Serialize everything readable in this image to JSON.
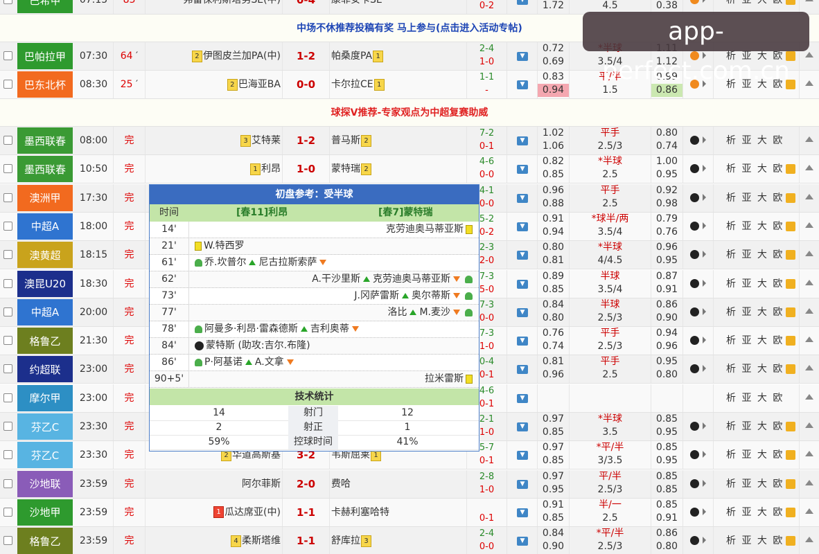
{
  "watermark": "app-perfect.com.cn",
  "banners": [
    "中场不休推荐投稿有奖 马上参与(点击进入活动专帖)",
    "球探V推荐-专家观点为中超复赛助威"
  ],
  "top_partial": {
    "league": "巴希甲",
    "time": "07:15",
    "status": "83",
    "home": "弗雷保利斯塔努SE(中)",
    "score": "0-4",
    "away": "康菲安卡SE",
    "half": "0-2",
    "o1": "1.72",
    "hc": "4.5",
    "o2": "0.38",
    "links": "析 亚 大 欧"
  },
  "matches": [
    {
      "league": "巴帕拉甲",
      "lcolor": "#2e9a2e",
      "time": "07:30",
      "status": "64",
      "live": true,
      "home": "伊图皮兰加PA(中)",
      "hrank": "2",
      "score": "1-2",
      "away": "帕桑度PA",
      "arank": "1",
      "half_top": "2-4",
      "half_bot": "1-0",
      "o1a": "0.72",
      "o1b": "0.69",
      "hca": "*半球",
      "hcb": "3.5/4",
      "o2a": "1.11",
      "o2b": "1.12",
      "ball": "#f08a1e",
      "links": "析 亚 大 欧"
    },
    {
      "league": "巴东北杯",
      "lcolor": "#f26a1f",
      "time": "08:30",
      "status": "25",
      "live": true,
      "home": "巴海亚BA",
      "hrank": "2",
      "score": "0-0",
      "away": "卡尔拉CE",
      "arank": "1",
      "half_top": "1-1",
      "half_bot": "-",
      "o1a": "0.83",
      "o1b": "0.94",
      "hca": "平/半",
      "hcb": "1.5",
      "o2a": "0.99",
      "o2b": "0.86",
      "ball": "#f08a1e",
      "links": "析 亚 大 欧"
    },
    {
      "league": "墨西联春",
      "lcolor": "#3a9a34",
      "time": "08:00",
      "status": "完",
      "home": "艾特莱",
      "hrank": "3",
      "score": "1-2",
      "away": "普马斯",
      "arank": "2",
      "half_top": "7-2",
      "half_bot": "0-1",
      "o1a": "1.02",
      "o1b": "1.06",
      "hca": "平手",
      "hcb": "2.5/3",
      "o2a": "0.80",
      "o2b": "0.74",
      "ball": "#222",
      "links": "析 亚 大 欧"
    },
    {
      "league": "墨西联春",
      "lcolor": "#3a9a34",
      "time": "10:50",
      "status": "完",
      "home": "利昂",
      "hrank": "1",
      "score": "1-0",
      "away": "蒙特瑞",
      "arank": "2",
      "half_top": "4-6",
      "half_bot": "0-0",
      "o1a": "0.82",
      "o1b": "0.85",
      "hca": "*半球",
      "hcb": "2.5",
      "o2a": "1.00",
      "o2b": "0.95",
      "ball": "#222",
      "links": "析 亚 大 欧"
    },
    {
      "league": "澳洲甲",
      "lcolor": "#f26a1f",
      "time": "17:30",
      "status": "完",
      "home": "",
      "hrank": "",
      "score": "",
      "away": "",
      "arank": "",
      "half_top": "4-1",
      "half_bot": "0-0",
      "o1a": "0.96",
      "o1b": "0.88",
      "hca": "平手",
      "hcb": "2.5",
      "o2a": "0.92",
      "o2b": "0.98",
      "ball": "#222",
      "links": "析 亚 大 欧"
    },
    {
      "league": "中超A",
      "lcolor": "#2f74d0",
      "time": "18:00",
      "status": "完",
      "home": "",
      "hrank": "",
      "score": "",
      "away": "",
      "arank": "",
      "half_top": "5-2",
      "half_bot": "0-2",
      "o1a": "0.91",
      "o1b": "0.94",
      "hca": "*球半/两",
      "hcb": "3.5/4",
      "o2a": "0.79",
      "o2b": "0.76",
      "ball": "#222",
      "links": "析 亚 大 欧"
    },
    {
      "league": "澳黄超",
      "lcolor": "#c9a31c",
      "time": "18:15",
      "status": "完",
      "home": "",
      "hrank": "",
      "score": "",
      "away": "",
      "arank": "",
      "half_top": "2-3",
      "half_bot": "2-0",
      "o1a": "0.80",
      "o1b": "0.81",
      "hca": "*半球",
      "hcb": "4/4.5",
      "o2a": "0.96",
      "o2b": "0.95",
      "ball": "#222",
      "links": "析 亚 大 欧"
    },
    {
      "league": "澳昆U20",
      "lcolor": "#1c2f8c",
      "time": "18:30",
      "status": "完",
      "home": "",
      "hrank": "",
      "score": "",
      "away": "",
      "arank": "",
      "half_top": "7-3",
      "half_bot": "5-0",
      "o1a": "0.89",
      "o1b": "0.85",
      "hca": "半球",
      "hcb": "3.5/4",
      "o2a": "0.87",
      "o2b": "0.91",
      "ball": "#222",
      "links": "析 亚 大 欧"
    },
    {
      "league": "中超A",
      "lcolor": "#2f74d0",
      "time": "20:00",
      "status": "完",
      "home": "",
      "hrank": "",
      "score": "",
      "away": "",
      "arank": "",
      "half_top": "7-3",
      "half_bot": "0-0",
      "o1a": "0.84",
      "o1b": "0.80",
      "hca": "半球",
      "hcb": "2.5/3",
      "o2a": "0.86",
      "o2b": "0.90",
      "ball": "#222",
      "links": "析 亚 大 欧"
    },
    {
      "league": "格鲁乙",
      "lcolor": "#6d7f1f",
      "time": "21:30",
      "status": "完",
      "home": "",
      "hrank": "",
      "score": "",
      "away": "",
      "arank": "",
      "half_top": "7-3",
      "half_bot": "1-0",
      "o1a": "0.76",
      "o1b": "0.74",
      "hca": "平手",
      "hcb": "2.5/3",
      "o2a": "0.94",
      "o2b": "0.96",
      "ball": "#222",
      "links": "析 亚 大 欧"
    },
    {
      "league": "约超联",
      "lcolor": "#1c2f8c",
      "time": "23:00",
      "status": "完",
      "home": "",
      "hrank": "",
      "score": "",
      "away": "",
      "arank": "",
      "half_top": "0-4",
      "half_bot": "0-1",
      "o1a": "0.81",
      "o1b": "0.96",
      "hca": "平手",
      "hcb": "2.5",
      "o2a": "0.95",
      "o2b": "0.80",
      "ball": "#222",
      "links": "析 亚 大 欧"
    },
    {
      "league": "摩尔甲",
      "lcolor": "#2d8fc4",
      "time": "23:00",
      "status": "完",
      "home": "",
      "hrank": "",
      "score": "",
      "away": "",
      "arank": "",
      "half_top": "4-6",
      "half_bot": "0-1",
      "o1a": "",
      "o1b": "",
      "hca": "",
      "hcb": "",
      "o2a": "",
      "o2b": "",
      "ball": "",
      "links": "析 亚 大 欧"
    },
    {
      "league": "芬乙C",
      "lcolor": "#58b4e2",
      "time": "23:30",
      "status": "完",
      "home": "",
      "hrank": "",
      "score": "",
      "away": "",
      "arank": "",
      "half_top": "2-1",
      "half_bot": "1-0",
      "o1a": "0.97",
      "o1b": "0.85",
      "hca": "*半球",
      "hcb": "3.5",
      "o2a": "0.85",
      "o2b": "0.95",
      "ball": "#222",
      "links": "析 亚 大 欧"
    },
    {
      "league": "芬乙C",
      "lcolor": "#58b4e2",
      "time": "23:30",
      "status": "完",
      "home": "华道高斯基",
      "hrank": "2",
      "score": "3-2",
      "away": "韦斯屈莱",
      "arank": "1",
      "half_top": "5-7",
      "half_bot": "0-1",
      "o1a": "0.97",
      "o1b": "0.85",
      "hca": "*平/半",
      "hcb": "3/3.5",
      "o2a": "0.85",
      "o2b": "0.95",
      "ball": "#222",
      "links": "析 亚 大 欧"
    },
    {
      "league": "沙地联",
      "lcolor": "#8a5cb8",
      "time": "23:59",
      "status": "完",
      "home": "阿尔菲斯",
      "hrank": "",
      "score": "2-0",
      "away": "费哈",
      "arank": "",
      "half_top": "2-8",
      "half_bot": "1-0",
      "o1a": "0.97",
      "o1b": "0.95",
      "hca": "平/半",
      "hcb": "2.5/3",
      "o2a": "0.85",
      "o2b": "0.85",
      "ball": "#222",
      "links": "析 亚 大 欧"
    },
    {
      "league": "沙地甲",
      "lcolor": "#2e9a2e",
      "time": "23:59",
      "status": "完",
      "home": "瓜达席亚(中)",
      "hrank": "1",
      "hred": true,
      "score": "1-1",
      "away": "卡赫利塞哈特",
      "arank": "",
      "half_top": "",
      "half_bot": "0-1",
      "o1a": "0.91",
      "o1b": "0.85",
      "hca": "半/一",
      "hcb": "2.5",
      "o2a": "0.85",
      "o2b": "0.91",
      "ball": "#222",
      "links": "析 亚 大 欧"
    },
    {
      "league": "格鲁乙",
      "lcolor": "#6d7f1f",
      "time": "23:59",
      "status": "完",
      "home": "柔斯塔维",
      "hrank": "4",
      "score": "1-1",
      "away": "舒库拉",
      "arank": "3",
      "half_top": "2-4",
      "half_bot": "0-0",
      "o1a": "0.84",
      "o1b": "0.90",
      "hca": "*平/半",
      "hcb": "2.5/3",
      "o2a": "0.86",
      "o2b": "0.80",
      "ball": "#222",
      "links": "析 亚 大 欧"
    }
  ],
  "popup": {
    "title": "初盘参考：受半球",
    "col_time": "时间",
    "home_team": "[春11]利昂",
    "away_team": "[春7]蒙特瑞",
    "events": [
      {
        "min": "14'",
        "side": "away",
        "text": "克劳迪奥马蒂亚斯",
        "icon": "ycard"
      },
      {
        "min": "21'",
        "side": "home",
        "text": "W.特西罗",
        "icon": "ycard"
      },
      {
        "min": "61'",
        "side": "home",
        "text": "乔.坎普尔",
        "text2": "尼古拉斯索萨",
        "icon": "sub"
      },
      {
        "min": "62'",
        "side": "away",
        "text": "A.干沙里斯",
        "text2": "克劳迪奥马蒂亚斯",
        "icon": "sub"
      },
      {
        "min": "73'",
        "side": "away",
        "text": "J.冈萨雷斯",
        "text2": "奥尔蒂斯",
        "icon": "sub"
      },
      {
        "min": "77'",
        "side": "away",
        "text": "洛比",
        "text2": "M.麦沙",
        "icon": "sub"
      },
      {
        "min": "78'",
        "side": "home",
        "text": "阿曼多·利昂·雷森德斯",
        "text2": "吉利奥蒂",
        "icon": "sub"
      },
      {
        "min": "84'",
        "side": "home",
        "text": "蒙特斯 (助攻:吉尔.布隆)",
        "icon": "goal"
      },
      {
        "min": "86'",
        "side": "home",
        "text": "P·阿基诺",
        "text2": "A.文拿",
        "icon": "sub"
      },
      {
        "min": "90+5'",
        "side": "away",
        "text": "拉米雷斯",
        "icon": "ycard"
      }
    ],
    "stats_title": "技术统计",
    "stats": [
      {
        "home": "14",
        "label": "射门",
        "away": "12"
      },
      {
        "home": "2",
        "label": "射正",
        "away": "1"
      },
      {
        "home": "59%",
        "label": "控球时间",
        "away": "41%"
      }
    ]
  }
}
